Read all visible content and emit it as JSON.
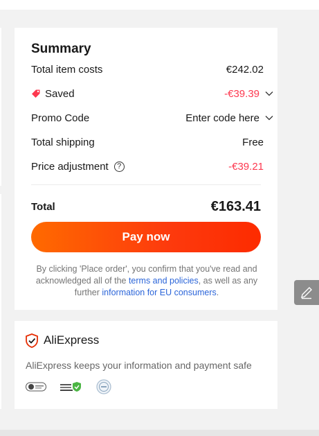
{
  "summary": {
    "title": "Summary",
    "total_item_costs": {
      "label": "Total item costs",
      "value": "€242.02"
    },
    "saved": {
      "label": "Saved",
      "value": "-€39.39"
    },
    "promo_code": {
      "label": "Promo Code",
      "value": "Enter code here"
    },
    "total_shipping": {
      "label": "Total shipping",
      "value": "Free"
    },
    "price_adjustment": {
      "label": "Price adjustment",
      "help": "?",
      "value": "-€39.21"
    },
    "total": {
      "label": "Total",
      "value": "€163.41"
    },
    "pay_button": "Pay now",
    "disclaimer": {
      "part1": "By clicking 'Place order', you confirm that you've read and acknowledged all of the ",
      "terms_link": "terms and policies",
      "part2": ", as well as any further ",
      "eu_link": "information for EU consumers",
      "part3": "."
    }
  },
  "safety": {
    "brand": "AliExpress",
    "message": "AliExpress keeps your information and payment safe"
  },
  "colors": {
    "accent": "#fd384f",
    "pay_gradient_start": "#ff6a00",
    "pay_gradient_end": "#fd2b00",
    "link": "#2b65d9"
  },
  "icons": [
    "tag-icon",
    "chevron-down-icon",
    "help-icon",
    "shield-check-icon",
    "edit-pencil-icon",
    "security-badge-icon"
  ]
}
